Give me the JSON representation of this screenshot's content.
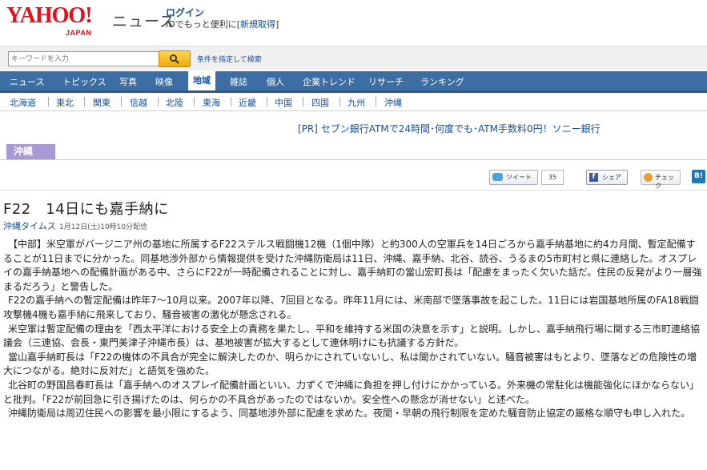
{
  "header": {
    "logo_main": "YAHOO!",
    "logo_sub": "JAPAN",
    "service": "ニュース",
    "login": "ログイン",
    "login_sub_prefix": "IDでもっと便利に[",
    "login_sub_link": "新規取得",
    "login_sub_suffix": "]"
  },
  "search": {
    "placeholder": "キーワードを入力",
    "advanced": "条件を指定して検索"
  },
  "nav": {
    "items": [
      "ニュース",
      "トピックス",
      "写真",
      "映像",
      "地域",
      "雑誌",
      "個人",
      "企業トレンド",
      "リサーチ",
      "ランキング"
    ],
    "active": "地域"
  },
  "subnav": {
    "items": [
      "北海道",
      "東北",
      "関東",
      "信越",
      "北陸",
      "東海",
      "近畿",
      "中国",
      "四国",
      "九州",
      "沖縄"
    ]
  },
  "pr": "[PR] セブン銀行ATMで24時間･何度でも･ATM手数料0円！ソニー銀行",
  "category": "沖縄",
  "social": {
    "tweet": "ツイート",
    "tweet_count": "35",
    "share": "シェア",
    "check": "チェック",
    "hatena": "B!"
  },
  "article": {
    "title": "F22　14日にも嘉手納に",
    "source": "沖縄タイムス",
    "date": "1月12日(土)10時10分配信",
    "paragraphs": [
      "【中部】米空軍がバージニア州の基地に所属するF22ステルス戦闘機12機（1個中隊）と約300人の空軍兵を14日ごろから嘉手納基地に約4カ月間、暫定配備することが11日までに分かった。同基地渉外部から情報提供を受けた沖縄防衛局は11日、沖縄、嘉手納、北谷、読谷、うるまの5市町村と県に連絡した。オスプレイの嘉手納基地への配備計画がある中、さらにF22が一時配備されることに対し、嘉手納町の當山宏町長は「配慮をまったく欠いた話だ。住民の反発がより一層強まるだろう」と警告した。",
      "F22の嘉手納への暫定配備は昨年7～10月以来。2007年以降、7回目となる。昨年11月には、米南部で墜落事故を起こした。11日には岩国基地所属のFA18戦闘攻撃機4機も嘉手納に飛来しており、騒音被害の激化が懸念される。",
      "米空軍は暫定配備の理由を「西太平洋における安全上の責務を果たし、平和を維持する米国の決意を示す」と説明。しかし、嘉手納飛行場に関する三市町連絡協議会（三連協、会長・東門美津子沖縄市長）は、基地被害が拡大するとして連休明けにも抗議する方針だ。",
      "當山嘉手納町長は「F22の機体の不具合が完全に解決したのか、明らかにされていないし、私は聞かされていない。騒音被害はもとより、墜落などの危険性の増大につながる。絶対に反対だ」と語気を強めた。",
      "北谷町の野国昌春町長は「嘉手納へのオスプレイ配備計画といい、力ずくで沖縄に負担を押し付けにかかっている。外来機の常駐化は機能強化にほかならない」と批判。「F22が前回急に引き揚げたのは、何らかの不具合があったのではないか。安全性への懸念が消せない」と述べた。",
      "沖縄防衛局は周辺住民への影響を最小限にするよう、同基地渉外部に配慮を求めた。夜間・早朝の飛行制限を定めた騒音防止協定の厳格な順守も申し入れた。"
    ]
  }
}
